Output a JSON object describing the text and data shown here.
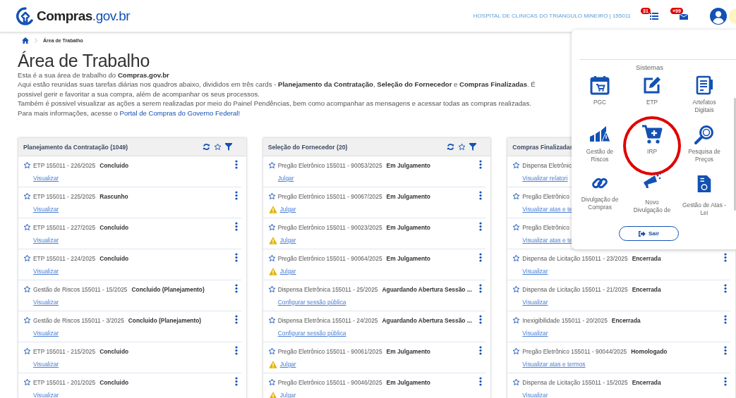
{
  "header": {
    "logo": {
      "name": "Compras",
      "domain": ".gov.br"
    },
    "organization": "HOSPITAL DE CLINICAS DO TRIANGULO MINEIRO | 155011",
    "notifications": [
      {
        "badge": "31"
      },
      {
        "badge": "+99"
      }
    ]
  },
  "breadcrumb": [
    "Área de Trabalho"
  ],
  "page_title": "Área de Trabalho",
  "intro": [
    "Esta é a sua área de trabalho do **Compras.gov.br**",
    "Aqui estão reunidas suas tarefas diárias nos quadros abaixo, divididos em três cards - **Planejamento da Contratação**, **Seleção do Fornecedor** e **Compras Finalizadas**. É possivel gerir e favoritar a sua compra, além de acompanhar os seus processos.",
    "Também é possivel visualizar as ações a serem realizadas por meio do Painel Pendências, bem como acompanhar as mensagens e acessar todas as compras realizadas."
  ],
  "intro_link": {
    "text": "Para mais informações, acesse o",
    "link": "Portal de Compras do Governo Federal!"
  },
  "cards": [
    {
      "title": "Planejamento da Contratação (1049)",
      "tools": true,
      "rows": [
        {
          "name": "ETP 155011 - 226/2025",
          "status": "Concluido",
          "action": "Visualizar",
          "warning": false,
          "menu": true
        },
        {
          "name": "ETP 155011 - 225/2025",
          "status": "Rascunho",
          "action": "Visualizar",
          "warning": false,
          "menu": true
        },
        {
          "name": "ETP 155011 - 227/2025",
          "status": "Concluido",
          "action": "Visualizar",
          "warning": false,
          "menu": true
        },
        {
          "name": "ETP 155011 - 224/2025",
          "status": "Concluido",
          "action": "Visualizar",
          "warning": false,
          "menu": true
        },
        {
          "name": "Gestão de Riscos 155011 - 15/2025",
          "status": "Concluido (Planejamento)",
          "action": "Visualizar",
          "warning": false,
          "menu": true
        },
        {
          "name": "Gestão de Riscos 155011 - 3/2025",
          "status": "Concluido (Planejamento)",
          "action": "Visualizar",
          "warning": false,
          "menu": true
        },
        {
          "name": "ETP 155011 - 215/2025",
          "status": "Concluido",
          "action": "Visualizar",
          "warning": false,
          "menu": true
        },
        {
          "name": "ETP 155011 - 201/2025",
          "status": "Concluido",
          "action": "Visualizar",
          "warning": false,
          "menu": true
        }
      ]
    },
    {
      "title": "Seleção do Fornecedor (20)",
      "tools": true,
      "rows": [
        {
          "name": "Pregão Eletrônico 155011 - 90053/2025",
          "status": "Em Julgamento",
          "action": "Julgar",
          "warning": false,
          "menu": true
        },
        {
          "name": "Pregão Eletrônico 155011 - 90067/2025",
          "status": "Em Julgamento",
          "action": "Julgar",
          "warning": true,
          "menu": true
        },
        {
          "name": "Pregão Eletrônico 155011 - 90023/2025",
          "status": "Em Julgamento",
          "action": "Julgar",
          "warning": true,
          "menu": true
        },
        {
          "name": "Pregão Eletrônico 155011 - 90064/2025",
          "status": "Em Julgamento",
          "action": "Julgar",
          "warning": true,
          "menu": true
        },
        {
          "name": "Dispensa Eletrônica 155011 - 25/2025",
          "status": "Aguardando Abertura Sessão ...",
          "action": "Configurar sessão pública",
          "warning": false,
          "menu": true
        },
        {
          "name": "Dispensa Eletrônica 155011 - 24/2025",
          "status": "Aguardando Abertura Sessão ...",
          "action": "Configurar sessão pública",
          "warning": false,
          "menu": true
        },
        {
          "name": "Pregão Eletrônico 155011 - 90061/2025",
          "status": "Em Julgamento",
          "action": "Julgar",
          "warning": true,
          "menu": true
        },
        {
          "name": "Pregão Eletrônico 155011 - 90046/2025",
          "status": "Em Julgamento",
          "action": "Julgar",
          "warning": true,
          "menu": true
        }
      ]
    },
    {
      "title": "Compras Finalizadas",
      "tools": false,
      "rows": [
        {
          "name": "Dispensa Eletrônic",
          "action": "Visualizar relatori",
          "warning": false,
          "menu": false
        },
        {
          "name": "Pregão Eletrônico",
          "action": "Visualizar atas e te",
          "warning": false,
          "menu": false
        },
        {
          "name": "Pregão Eletrônico",
          "action": "Visualizar atas e te",
          "warning": false,
          "menu": false
        },
        {
          "name": "Dispensa de Licitação 155011 - 23/2025",
          "status": "Encerrada",
          "action": "Visualizar",
          "warning": false,
          "menu": true
        },
        {
          "name": "Dispensa de Licitação 155011 - 21/2025",
          "status": "Encerrada",
          "action": "Visualizar",
          "warning": false,
          "menu": true
        },
        {
          "name": "Inexigibilidade 155011 - 20/2025",
          "status": "Encerrada",
          "action": "Visualizar",
          "warning": false,
          "menu": true
        },
        {
          "name": "Pregão Eletrônico 155011 - 90044/2025",
          "status": "Homologado",
          "action": "Visualizar atas e termos",
          "warning": false,
          "menu": true
        },
        {
          "name": "Dispensa de Licitação 155011 - 15/2025",
          "status": "Encerrada",
          "action": "Visualizar",
          "warning": false,
          "menu": true
        }
      ]
    }
  ],
  "systems_menu": {
    "heading": "Sistemas",
    "items": [
      {
        "label": "PGC",
        "selected": false
      },
      {
        "label": "ETP",
        "selected": false
      },
      {
        "label": "Artefatos Digitais",
        "selected": false
      },
      {
        "label": "Gestão de Riscos",
        "selected": false
      },
      {
        "label": "IRP",
        "selected": true
      },
      {
        "label": "Pesquisa de Preços",
        "selected": false
      },
      {
        "label": "Divulgação de Compras",
        "selected": false
      },
      {
        "label": "Novo Divulgação de",
        "selected": false
      },
      {
        "label": "Gestão de Atas - Lei",
        "selected": false
      }
    ],
    "logout": "Sair"
  }
}
